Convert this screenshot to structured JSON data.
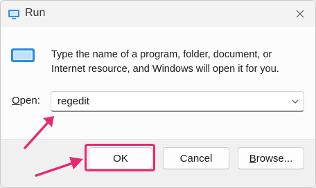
{
  "window": {
    "title": "Run",
    "icon": "run-app-icon",
    "close_icon": "close-icon"
  },
  "content": {
    "description": "Type the name of a program, folder, document, or Internet resource, and Windows will open it for you.",
    "open_label_prefix": "O",
    "open_label_rest": "pen:",
    "open_value": "regedit"
  },
  "buttons": {
    "ok": "OK",
    "cancel": "Cancel",
    "browse_prefix": "B",
    "browse_rest": "rowse..."
  },
  "annotations": {
    "highlight_color": "#e52a74"
  }
}
